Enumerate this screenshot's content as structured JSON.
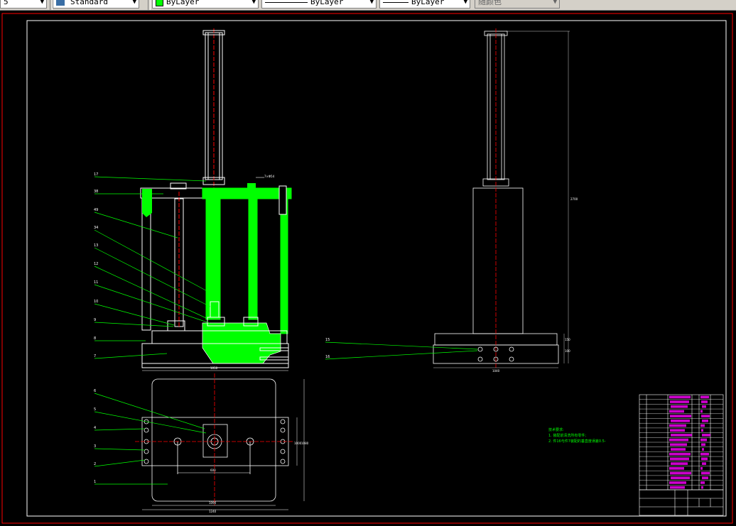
{
  "toolbar": {
    "scale_value": "5",
    "textstyle_value": "Standard",
    "color_value": "ByLayer",
    "linetype_value": "ByLayer",
    "lineweight_value": "ByLayer",
    "plotstyle_value": "随颜色",
    "color_swatch": "#00ff00"
  },
  "colors": {
    "frame": "#ff0000",
    "geometry": "#ffffff",
    "highlight": "#00ff00",
    "centerline": "#ff0000",
    "leader": "#00ff00",
    "titleblock_text": "#ff00ff"
  },
  "drawing": {
    "callouts_front": [
      "17",
      "38",
      "49",
      "34",
      "13",
      "12",
      "11",
      "10",
      "9",
      "8",
      "7"
    ],
    "callouts_plan": [
      "6",
      "5",
      "4",
      "3",
      "2",
      "1"
    ],
    "callouts_side": [
      "15",
      "16"
    ],
    "dims": {
      "front_width": "1050",
      "side_width": "1040",
      "side_height": "2700",
      "plan_inner": "600",
      "plan_width": "1090",
      "plan_outer": "1240",
      "plan_side_a": "1000",
      "plan_side_b": "1080",
      "top_note": "7×Φ54",
      "side_small_a": "150",
      "side_small_b": "100"
    },
    "tech_notes": {
      "title": "技术要求:",
      "line1": "1. 装配前清洗所有零件;",
      "line2": "2. 件16与件7装配的垂直度误差0.5-"
    }
  }
}
